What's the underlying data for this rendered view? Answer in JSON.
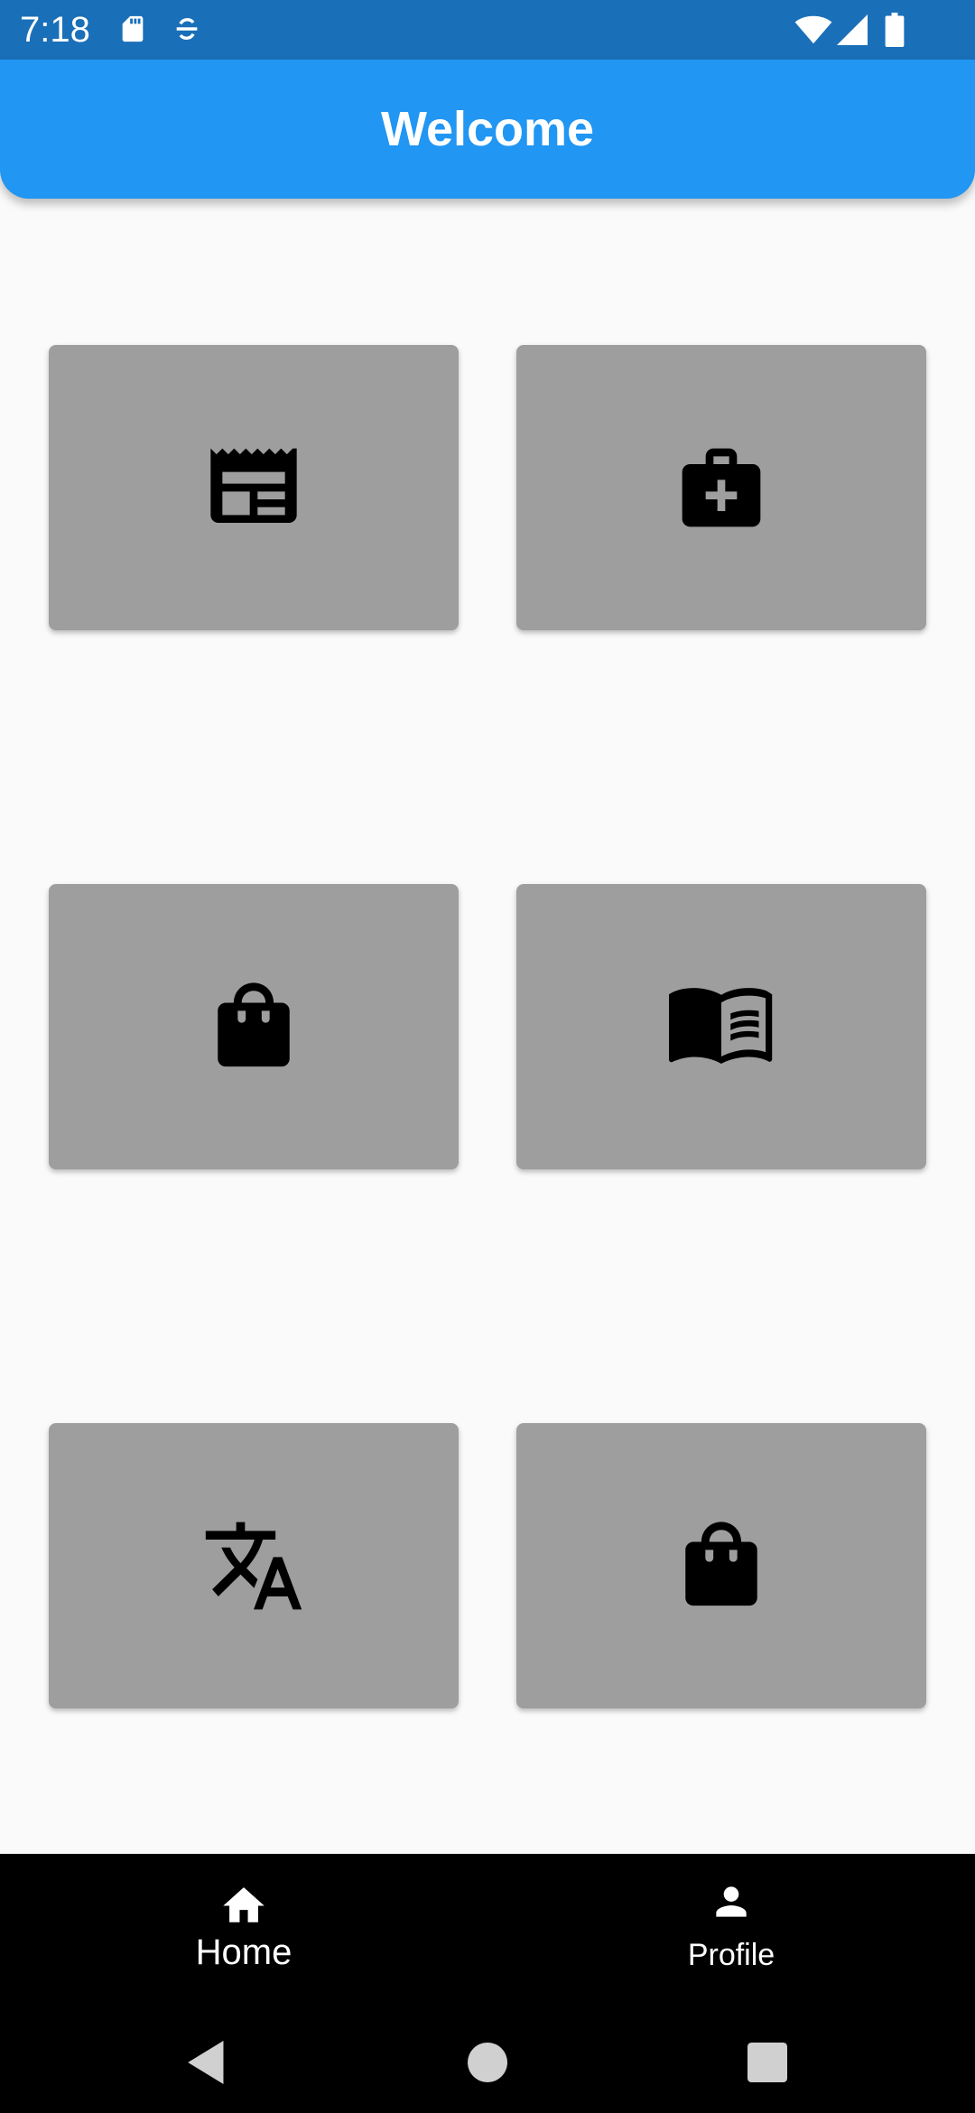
{
  "status_bar": {
    "time": "7:18",
    "icons": [
      "sd-card-icon",
      "sync-icon",
      "wifi-icon",
      "signal-icon",
      "battery-icon"
    ]
  },
  "app_bar": {
    "title": "Welcome",
    "color": "#2196f3"
  },
  "tiles": [
    {
      "icon": "newspaper-icon"
    },
    {
      "icon": "medical-bag-icon"
    },
    {
      "icon": "shopping-bag-icon"
    },
    {
      "icon": "menu-book-icon"
    },
    {
      "icon": "translate-icon"
    },
    {
      "icon": "shopping-bag-icon"
    }
  ],
  "bottom_nav": {
    "items": [
      {
        "label": "Home",
        "icon": "home-icon"
      },
      {
        "label": "Profile",
        "icon": "person-icon"
      }
    ]
  },
  "system_nav": {
    "buttons": [
      "back-icon",
      "home-circle-icon",
      "recents-icon"
    ]
  },
  "colors": {
    "status_bar": "#1a6fb9",
    "tile": "#9e9e9e",
    "background": "#fafafa",
    "nav_background": "#000000"
  }
}
